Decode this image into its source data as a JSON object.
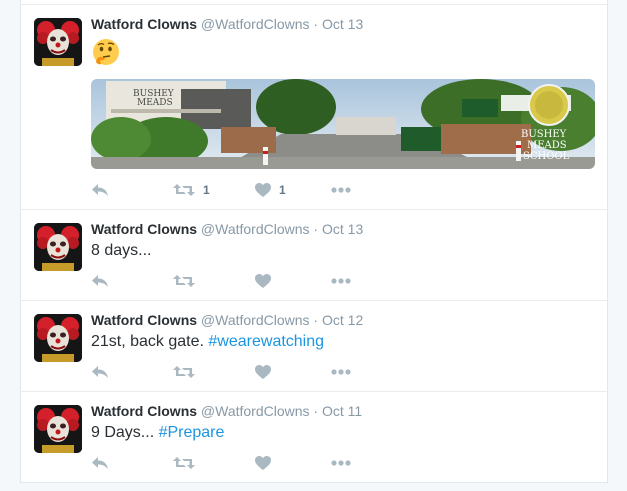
{
  "colors": {
    "link": "#1b95e0",
    "icon": "#aab8c2",
    "meta": "#8899a6"
  },
  "tweets": [
    {
      "name": "Watford Clowns",
      "handle": "@WatfordClowns",
      "separator": "·",
      "time": "Oct 13",
      "text": "",
      "emoji": "thinking-face-emoji",
      "media": {
        "signs": [
          "BUSHEY",
          "MEADS",
          "BUSHEY",
          "MEADS",
          "SCHOOL"
        ]
      },
      "retweets": "1",
      "likes": "1"
    },
    {
      "name": "Watford Clowns",
      "handle": "@WatfordClowns",
      "separator": "·",
      "time": "Oct 13",
      "text": "8 days...",
      "retweets": "",
      "likes": ""
    },
    {
      "name": "Watford Clowns",
      "handle": "@WatfordClowns",
      "separator": "·",
      "time": "Oct 12",
      "text": "21st, back gate. ",
      "hashtag": "#wearewatching",
      "retweets": "",
      "likes": ""
    },
    {
      "name": "Watford Clowns",
      "handle": "@WatfordClowns",
      "separator": "·",
      "time": "Oct 11",
      "text": "9 Days... ",
      "hashtag": "#Prepare",
      "retweets": "",
      "likes": ""
    }
  ]
}
